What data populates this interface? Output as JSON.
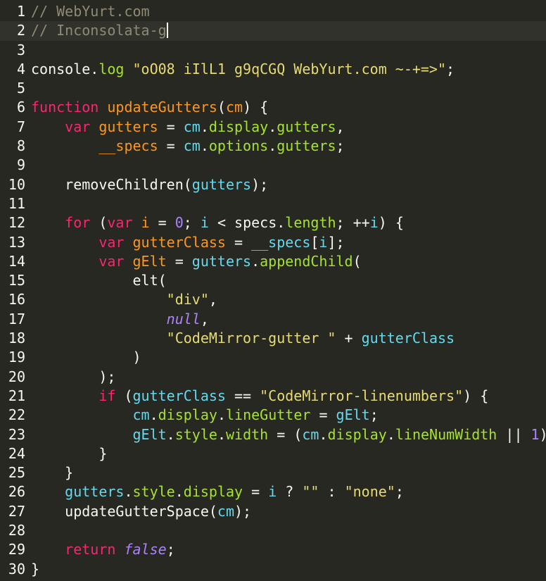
{
  "editor": {
    "active_line": 2,
    "colors": {
      "background": "#272822",
      "active_line": "#31322c",
      "text": "#f8f8f2",
      "comment": "#8f8a76",
      "keyword": "#f92672",
      "definition": "#fd971f",
      "variable": "#66d9ef",
      "property": "#a6e22e",
      "string": "#e6db74",
      "number": "#ae81ff"
    },
    "lines": [
      {
        "num": "1",
        "tokens": [
          [
            "comment",
            "// WebYurt.com"
          ]
        ]
      },
      {
        "num": "2",
        "tokens": [
          [
            "comment",
            "// Inconsolata-g"
          ]
        ],
        "cursor": true
      },
      {
        "num": "3",
        "tokens": []
      },
      {
        "num": "4",
        "tokens": [
          [
            "plain",
            "console."
          ],
          [
            "prop",
            "log"
          ],
          [
            "plain",
            " "
          ],
          [
            "string",
            "\"oO08 iIlL1 g9qCGQ WebYurt.com ~-+=>\""
          ],
          [
            "plain",
            ";"
          ]
        ]
      },
      {
        "num": "5",
        "tokens": []
      },
      {
        "num": "6",
        "tokens": [
          [
            "keyword",
            "function"
          ],
          [
            "plain",
            " "
          ],
          [
            "def",
            "updateGutters"
          ],
          [
            "plain",
            "("
          ],
          [
            "def",
            "cm"
          ],
          [
            "plain",
            ") {"
          ]
        ]
      },
      {
        "num": "7",
        "tokens": [
          [
            "plain",
            "    "
          ],
          [
            "keyword",
            "var"
          ],
          [
            "plain",
            " "
          ],
          [
            "def",
            "gutters"
          ],
          [
            "plain",
            " = "
          ],
          [
            "var",
            "cm"
          ],
          [
            "plain",
            "."
          ],
          [
            "prop",
            "display"
          ],
          [
            "plain",
            "."
          ],
          [
            "prop",
            "gutters"
          ],
          [
            "plain",
            ","
          ]
        ]
      },
      {
        "num": "8",
        "tokens": [
          [
            "plain",
            "        "
          ],
          [
            "def",
            "__specs"
          ],
          [
            "plain",
            " = "
          ],
          [
            "var",
            "cm"
          ],
          [
            "plain",
            "."
          ],
          [
            "prop",
            "options"
          ],
          [
            "plain",
            "."
          ],
          [
            "prop",
            "gutters"
          ],
          [
            "plain",
            ";"
          ]
        ]
      },
      {
        "num": "9",
        "tokens": []
      },
      {
        "num": "10",
        "tokens": [
          [
            "plain",
            "    removeChildren("
          ],
          [
            "var",
            "gutters"
          ],
          [
            "plain",
            ");"
          ]
        ]
      },
      {
        "num": "11",
        "tokens": []
      },
      {
        "num": "12",
        "tokens": [
          [
            "plain",
            "    "
          ],
          [
            "keyword",
            "for"
          ],
          [
            "plain",
            " ("
          ],
          [
            "keyword",
            "var"
          ],
          [
            "plain",
            " "
          ],
          [
            "def",
            "i"
          ],
          [
            "plain",
            " = "
          ],
          [
            "number",
            "0"
          ],
          [
            "plain",
            "; "
          ],
          [
            "var",
            "i"
          ],
          [
            "plain",
            " < specs."
          ],
          [
            "prop",
            "length"
          ],
          [
            "plain",
            "; ++"
          ],
          [
            "var",
            "i"
          ],
          [
            "plain",
            ") {"
          ]
        ]
      },
      {
        "num": "13",
        "tokens": [
          [
            "plain",
            "        "
          ],
          [
            "keyword",
            "var"
          ],
          [
            "plain",
            " "
          ],
          [
            "def",
            "gutterClass"
          ],
          [
            "plain",
            " = "
          ],
          [
            "var",
            "__specs"
          ],
          [
            "plain",
            "["
          ],
          [
            "var",
            "i"
          ],
          [
            "plain",
            "];"
          ]
        ]
      },
      {
        "num": "14",
        "tokens": [
          [
            "plain",
            "        "
          ],
          [
            "keyword",
            "var"
          ],
          [
            "plain",
            " "
          ],
          [
            "def",
            "gElt"
          ],
          [
            "plain",
            " = "
          ],
          [
            "var",
            "gutters"
          ],
          [
            "plain",
            "."
          ],
          [
            "prop",
            "appendChild"
          ],
          [
            "plain",
            "("
          ]
        ]
      },
      {
        "num": "15",
        "tokens": [
          [
            "plain",
            "            elt("
          ]
        ]
      },
      {
        "num": "16",
        "tokens": [
          [
            "plain",
            "                "
          ],
          [
            "string",
            "\"div\""
          ],
          [
            "plain",
            ","
          ]
        ]
      },
      {
        "num": "17",
        "tokens": [
          [
            "plain",
            "                "
          ],
          [
            "atom",
            "null"
          ],
          [
            "plain",
            ","
          ]
        ]
      },
      {
        "num": "18",
        "tokens": [
          [
            "plain",
            "                "
          ],
          [
            "string",
            "\"CodeMirror-gutter \""
          ],
          [
            "plain",
            " + "
          ],
          [
            "var",
            "gutterClass"
          ]
        ]
      },
      {
        "num": "19",
        "tokens": [
          [
            "plain",
            "            )"
          ]
        ]
      },
      {
        "num": "20",
        "tokens": [
          [
            "plain",
            "        );"
          ]
        ]
      },
      {
        "num": "21",
        "tokens": [
          [
            "plain",
            "        "
          ],
          [
            "keyword",
            "if"
          ],
          [
            "plain",
            " ("
          ],
          [
            "var",
            "gutterClass"
          ],
          [
            "plain",
            " == "
          ],
          [
            "string",
            "\"CodeMirror-linenumbers\""
          ],
          [
            "plain",
            ") {"
          ]
        ]
      },
      {
        "num": "22",
        "tokens": [
          [
            "plain",
            "            "
          ],
          [
            "var",
            "cm"
          ],
          [
            "plain",
            "."
          ],
          [
            "prop",
            "display"
          ],
          [
            "plain",
            "."
          ],
          [
            "prop",
            "lineGutter"
          ],
          [
            "plain",
            " = "
          ],
          [
            "var",
            "gElt"
          ],
          [
            "plain",
            ";"
          ]
        ]
      },
      {
        "num": "23",
        "tokens": [
          [
            "plain",
            "            "
          ],
          [
            "var",
            "gElt"
          ],
          [
            "plain",
            "."
          ],
          [
            "prop",
            "style"
          ],
          [
            "plain",
            "."
          ],
          [
            "prop",
            "width"
          ],
          [
            "plain",
            " = ("
          ],
          [
            "var",
            "cm"
          ],
          [
            "plain",
            "."
          ],
          [
            "prop",
            "display"
          ],
          [
            "plain",
            "."
          ],
          [
            "prop",
            "lineNumWidth"
          ],
          [
            "plain",
            " || "
          ],
          [
            "number",
            "1"
          ],
          [
            "plain",
            ") +"
          ]
        ]
      },
      {
        "num": "24",
        "tokens": [
          [
            "plain",
            "        }"
          ]
        ]
      },
      {
        "num": "25",
        "tokens": [
          [
            "plain",
            "    }"
          ]
        ]
      },
      {
        "num": "26",
        "tokens": [
          [
            "plain",
            "    "
          ],
          [
            "var",
            "gutters"
          ],
          [
            "plain",
            "."
          ],
          [
            "prop",
            "style"
          ],
          [
            "plain",
            "."
          ],
          [
            "prop",
            "display"
          ],
          [
            "plain",
            " = "
          ],
          [
            "var",
            "i"
          ],
          [
            "plain",
            " ? "
          ],
          [
            "string",
            "\"\""
          ],
          [
            "plain",
            " : "
          ],
          [
            "string",
            "\"none\""
          ],
          [
            "plain",
            ";"
          ]
        ]
      },
      {
        "num": "27",
        "tokens": [
          [
            "plain",
            "    updateGutterSpace("
          ],
          [
            "var",
            "cm"
          ],
          [
            "plain",
            ");"
          ]
        ]
      },
      {
        "num": "28",
        "tokens": []
      },
      {
        "num": "29",
        "tokens": [
          [
            "plain",
            "    "
          ],
          [
            "keyword",
            "return"
          ],
          [
            "plain",
            " "
          ],
          [
            "atom",
            "false"
          ],
          [
            "plain",
            ";"
          ]
        ]
      },
      {
        "num": "30",
        "tokens": [
          [
            "plain",
            "}"
          ]
        ]
      }
    ]
  }
}
